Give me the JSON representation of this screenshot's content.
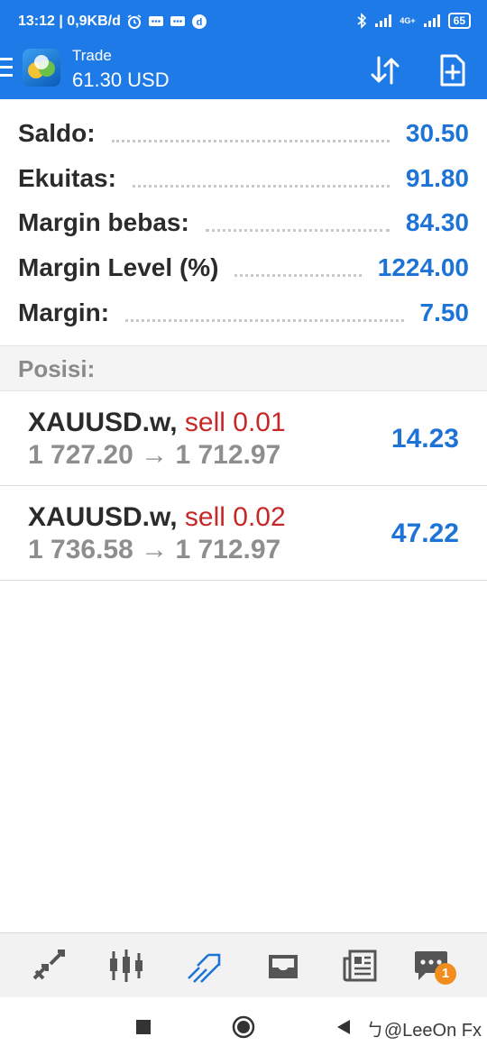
{
  "status_bar": {
    "time_speed": "13:12 | 0,9KB/d",
    "network_label": "4G+",
    "battery": "65"
  },
  "app_bar": {
    "title": "Trade",
    "subtitle": "61.30 USD",
    "icons": [
      "menu-icon",
      "app-logo-icon",
      "sort-icon",
      "new-order-icon"
    ]
  },
  "summary": [
    {
      "label": "Saldo:",
      "value": "30.50"
    },
    {
      "label": "Ekuitas:",
      "value": "91.80"
    },
    {
      "label": "Margin bebas:",
      "value": "84.30"
    },
    {
      "label": "Margin Level (%)",
      "value": "1224.00"
    },
    {
      "label": "Margin:",
      "value": "7.50"
    }
  ],
  "section_title": "Posisi:",
  "positions": [
    {
      "symbol": "XAUUSD.w,",
      "type": "sell 0.01",
      "prices": "1 727.20 → 1 712.97",
      "profit": "14.23"
    },
    {
      "symbol": "XAUUSD.w,",
      "type": "sell 0.02",
      "prices": "1 736.58 → 1 712.97",
      "profit": "47.22"
    }
  ],
  "tab_bar": {
    "tabs": [
      "quotes-icon",
      "chart-icon",
      "trade-icon",
      "history-icon",
      "news-icon",
      "chat-icon"
    ],
    "active_tab": "trade-icon",
    "chat_badge": "1"
  },
  "nav_bar": {
    "watermark": "@LeeOn Fx"
  },
  "colors": {
    "header_blue": "#1e7ae6",
    "value_blue": "#1d73d6",
    "sell_red": "#c62828",
    "badge_orange": "#f28c1c"
  }
}
